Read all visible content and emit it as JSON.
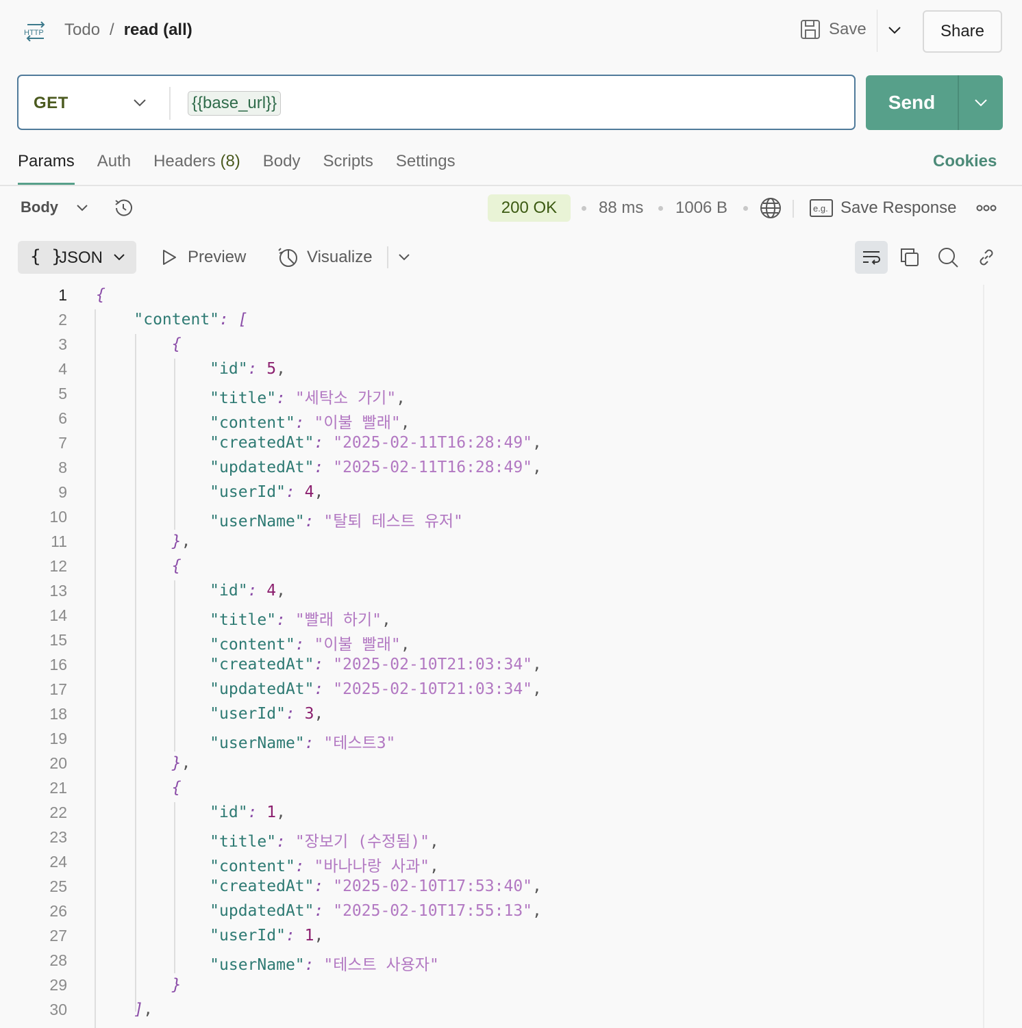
{
  "header": {
    "http_icon_text": "HTTP",
    "breadcrumb_parent": "Todo",
    "breadcrumb_sep": "/",
    "breadcrumb_current": "read (all)",
    "save_label": "Save",
    "share_label": "Share"
  },
  "request": {
    "method": "GET",
    "url_variable": "{{base_url}}",
    "send_label": "Send"
  },
  "tabs": [
    {
      "label": "Params",
      "active": true
    },
    {
      "label": "Auth"
    },
    {
      "label": "Headers",
      "count": "(8)"
    },
    {
      "label": "Body"
    },
    {
      "label": "Scripts"
    },
    {
      "label": "Settings"
    }
  ],
  "cookies_label": "Cookies",
  "response": {
    "body_label": "Body",
    "status": "200 OK",
    "time": "88 ms",
    "size": "1006 B",
    "save_response_label": "Save Response",
    "eg_icon_text": "e.g."
  },
  "toolbar": {
    "format_braces": "{ }",
    "format_label": "JSON",
    "preview_label": "Preview",
    "visualize_label": "Visualize"
  },
  "code_lines": [
    {
      "n": "1",
      "t": "{"
    },
    {
      "n": "2",
      "t": "    \"content\": ["
    },
    {
      "n": "3",
      "t": "        {"
    },
    {
      "n": "4",
      "t": "            \"id\": 5,"
    },
    {
      "n": "5",
      "t": "            \"title\": \"세탁소 가기\","
    },
    {
      "n": "6",
      "t": "            \"content\": \"이불 빨래\","
    },
    {
      "n": "7",
      "t": "            \"createdAt\": \"2025-02-11T16:28:49\","
    },
    {
      "n": "8",
      "t": "            \"updatedAt\": \"2025-02-11T16:28:49\","
    },
    {
      "n": "9",
      "t": "            \"userId\": 4,"
    },
    {
      "n": "10",
      "t": "            \"userName\": \"탈퇴 테스트 유저\""
    },
    {
      "n": "11",
      "t": "        },"
    },
    {
      "n": "12",
      "t": "        {"
    },
    {
      "n": "13",
      "t": "            \"id\": 4,"
    },
    {
      "n": "14",
      "t": "            \"title\": \"빨래 하기\","
    },
    {
      "n": "15",
      "t": "            \"content\": \"이불 빨래\","
    },
    {
      "n": "16",
      "t": "            \"createdAt\": \"2025-02-10T21:03:34\","
    },
    {
      "n": "17",
      "t": "            \"updatedAt\": \"2025-02-10T21:03:34\","
    },
    {
      "n": "18",
      "t": "            \"userId\": 3,"
    },
    {
      "n": "19",
      "t": "            \"userName\": \"테스트3\""
    },
    {
      "n": "20",
      "t": "        },"
    },
    {
      "n": "21",
      "t": "        {"
    },
    {
      "n": "22",
      "t": "            \"id\": 1,"
    },
    {
      "n": "23",
      "t": "            \"title\": \"장보기 (수정됨)\","
    },
    {
      "n": "24",
      "t": "            \"content\": \"바나나랑 사과\","
    },
    {
      "n": "25",
      "t": "            \"createdAt\": \"2025-02-10T17:53:40\","
    },
    {
      "n": "26",
      "t": "            \"updatedAt\": \"2025-02-10T17:55:13\","
    },
    {
      "n": "27",
      "t": "            \"userId\": 1,"
    },
    {
      "n": "28",
      "t": "            \"userName\": \"테스트 사용자\""
    },
    {
      "n": "29",
      "t": "        }"
    },
    {
      "n": "30",
      "t": "    ],"
    }
  ],
  "colors": {
    "accent": "#57a08a",
    "json_key": "#2e7a73",
    "json_string": "#b278c2",
    "json_number": "#8b1f6e",
    "json_punct": "#8b4da8"
  }
}
